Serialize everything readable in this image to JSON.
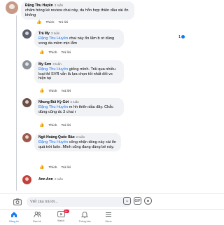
{
  "comments": [
    {
      "name": "Đặng Thu Huyền",
      "time": "3 tuần",
      "text": "chấm hóng ké review chai này, da hỗn hợp thiên dầu xài ổn không",
      "like": "Thích",
      "reply": "Trả lời"
    },
    {
      "name": "Trà My",
      "time": "3 tuần",
      "mention": "Đặng Thu Huyền",
      "text": " chai này ổn lắm b ơi dùng xong da mềm mịn lắm",
      "like": "Thích",
      "reply": "Trả lời",
      "reactions": "1"
    },
    {
      "name": "My Sơn",
      "time": "3 tuần",
      "mention": "Đặng Thu Huyền",
      "text": " giống mình. Trải qua nhiều loại thì SVR vẫn là lựa chọn tốt nhất đối vs hiện tại",
      "like": "Thích",
      "reply": "Trả lời"
    },
    {
      "name": "Nhung Bùi Kỳ Gửi",
      "time": "3 tuần",
      "mention": "Đặng Thu Huyền",
      "text": " m hh thiên dầu đây. Chắc dùng cũng dc 3 chai r",
      "like": "Thích",
      "reply": "Trả lời"
    },
    {
      "name": "Ngô Hoàng Quốc Bảo",
      "time": "2 tuần",
      "mention": "Đặng Thu Huyền",
      "text": " công nhận dòng này xài ổn quá trời luôn. Mình cũng đang dùng bé này.",
      "like": "Thích",
      "reply": "Trả lời"
    },
    {
      "name": "Ann Ann",
      "time": "2 tuần"
    }
  ],
  "composer": {
    "placeholder": "Viết câu trả lời..."
  },
  "nav": [
    {
      "label": "Bảng tin",
      "icon": "home-icon"
    },
    {
      "label": "Bạn bè",
      "icon": "friends-icon"
    },
    {
      "label": "Watch",
      "icon": "watch-icon",
      "badge": "9+"
    },
    {
      "label": "Thông báo",
      "icon": "bell-icon"
    },
    {
      "label": "Menu",
      "icon": "menu-icon"
    }
  ],
  "colors": {
    "accent": "#1877f2",
    "bubble": "#f0f2f5",
    "secondary_text": "#65676b",
    "badge": "#e41e3f"
  }
}
